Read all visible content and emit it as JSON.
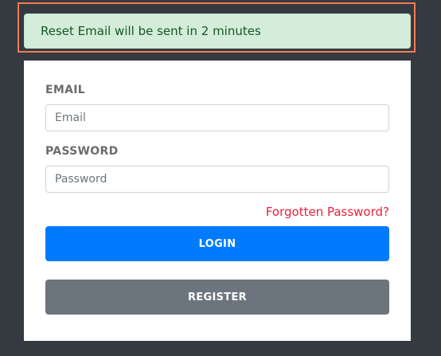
{
  "alert": {
    "message": "Reset Email will be sent in 2 minutes"
  },
  "form": {
    "email_label": "EMAIL",
    "email_placeholder": "Email",
    "email_value": "",
    "password_label": "PASSWORD",
    "password_placeholder": "Password",
    "password_value": "",
    "forgot_link": "Forgotten Password?",
    "login_label": "LOGIN",
    "register_label": "REGISTER"
  },
  "colors": {
    "background": "#343a40",
    "alert_bg": "#d4edda",
    "alert_text": "#155724",
    "link": "#e8203a",
    "primary": "#007bff",
    "secondary": "#6c757d",
    "highlight_frame": "#f47a55"
  }
}
